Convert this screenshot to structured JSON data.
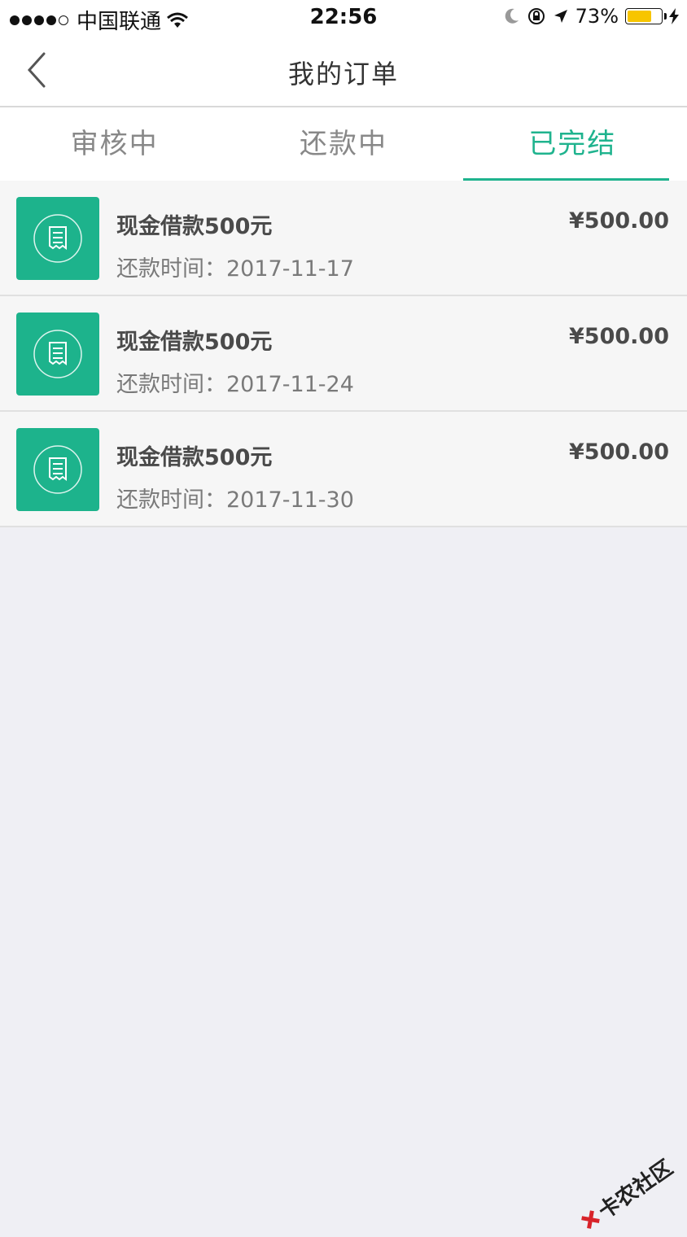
{
  "status_bar": {
    "carrier": "中国联通",
    "time": "22:56",
    "battery_percent": "73%",
    "battery_level": 0.73,
    "icons": [
      "signal-dots-icon",
      "wifi-icon",
      "moon-icon",
      "rotation-lock-icon",
      "location-arrow-icon",
      "battery-icon",
      "charging-bolt-icon"
    ]
  },
  "navbar": {
    "title": "我的订单",
    "back_icon": "chevron-left-icon"
  },
  "tabs": [
    {
      "label": "审核中",
      "active": false
    },
    {
      "label": "还款中",
      "active": false
    },
    {
      "label": "已完结",
      "active": true
    }
  ],
  "orders": [
    {
      "name": "现金借款500元",
      "date_label": "还款时间：2017-11-17",
      "amount": "¥500.00",
      "icon": "receipt-icon"
    },
    {
      "name": "现金借款500元",
      "date_label": "还款时间：2017-11-24",
      "amount": "¥500.00",
      "icon": "receipt-icon"
    },
    {
      "name": "现金借款500元",
      "date_label": "还款时间：2017-11-30",
      "amount": "¥500.00",
      "icon": "receipt-icon"
    }
  ],
  "colors": {
    "accent": "#1fb38e",
    "background": "#efeff4",
    "row_background": "#f6f6f6"
  },
  "watermark": {
    "text": "卡农社区"
  }
}
